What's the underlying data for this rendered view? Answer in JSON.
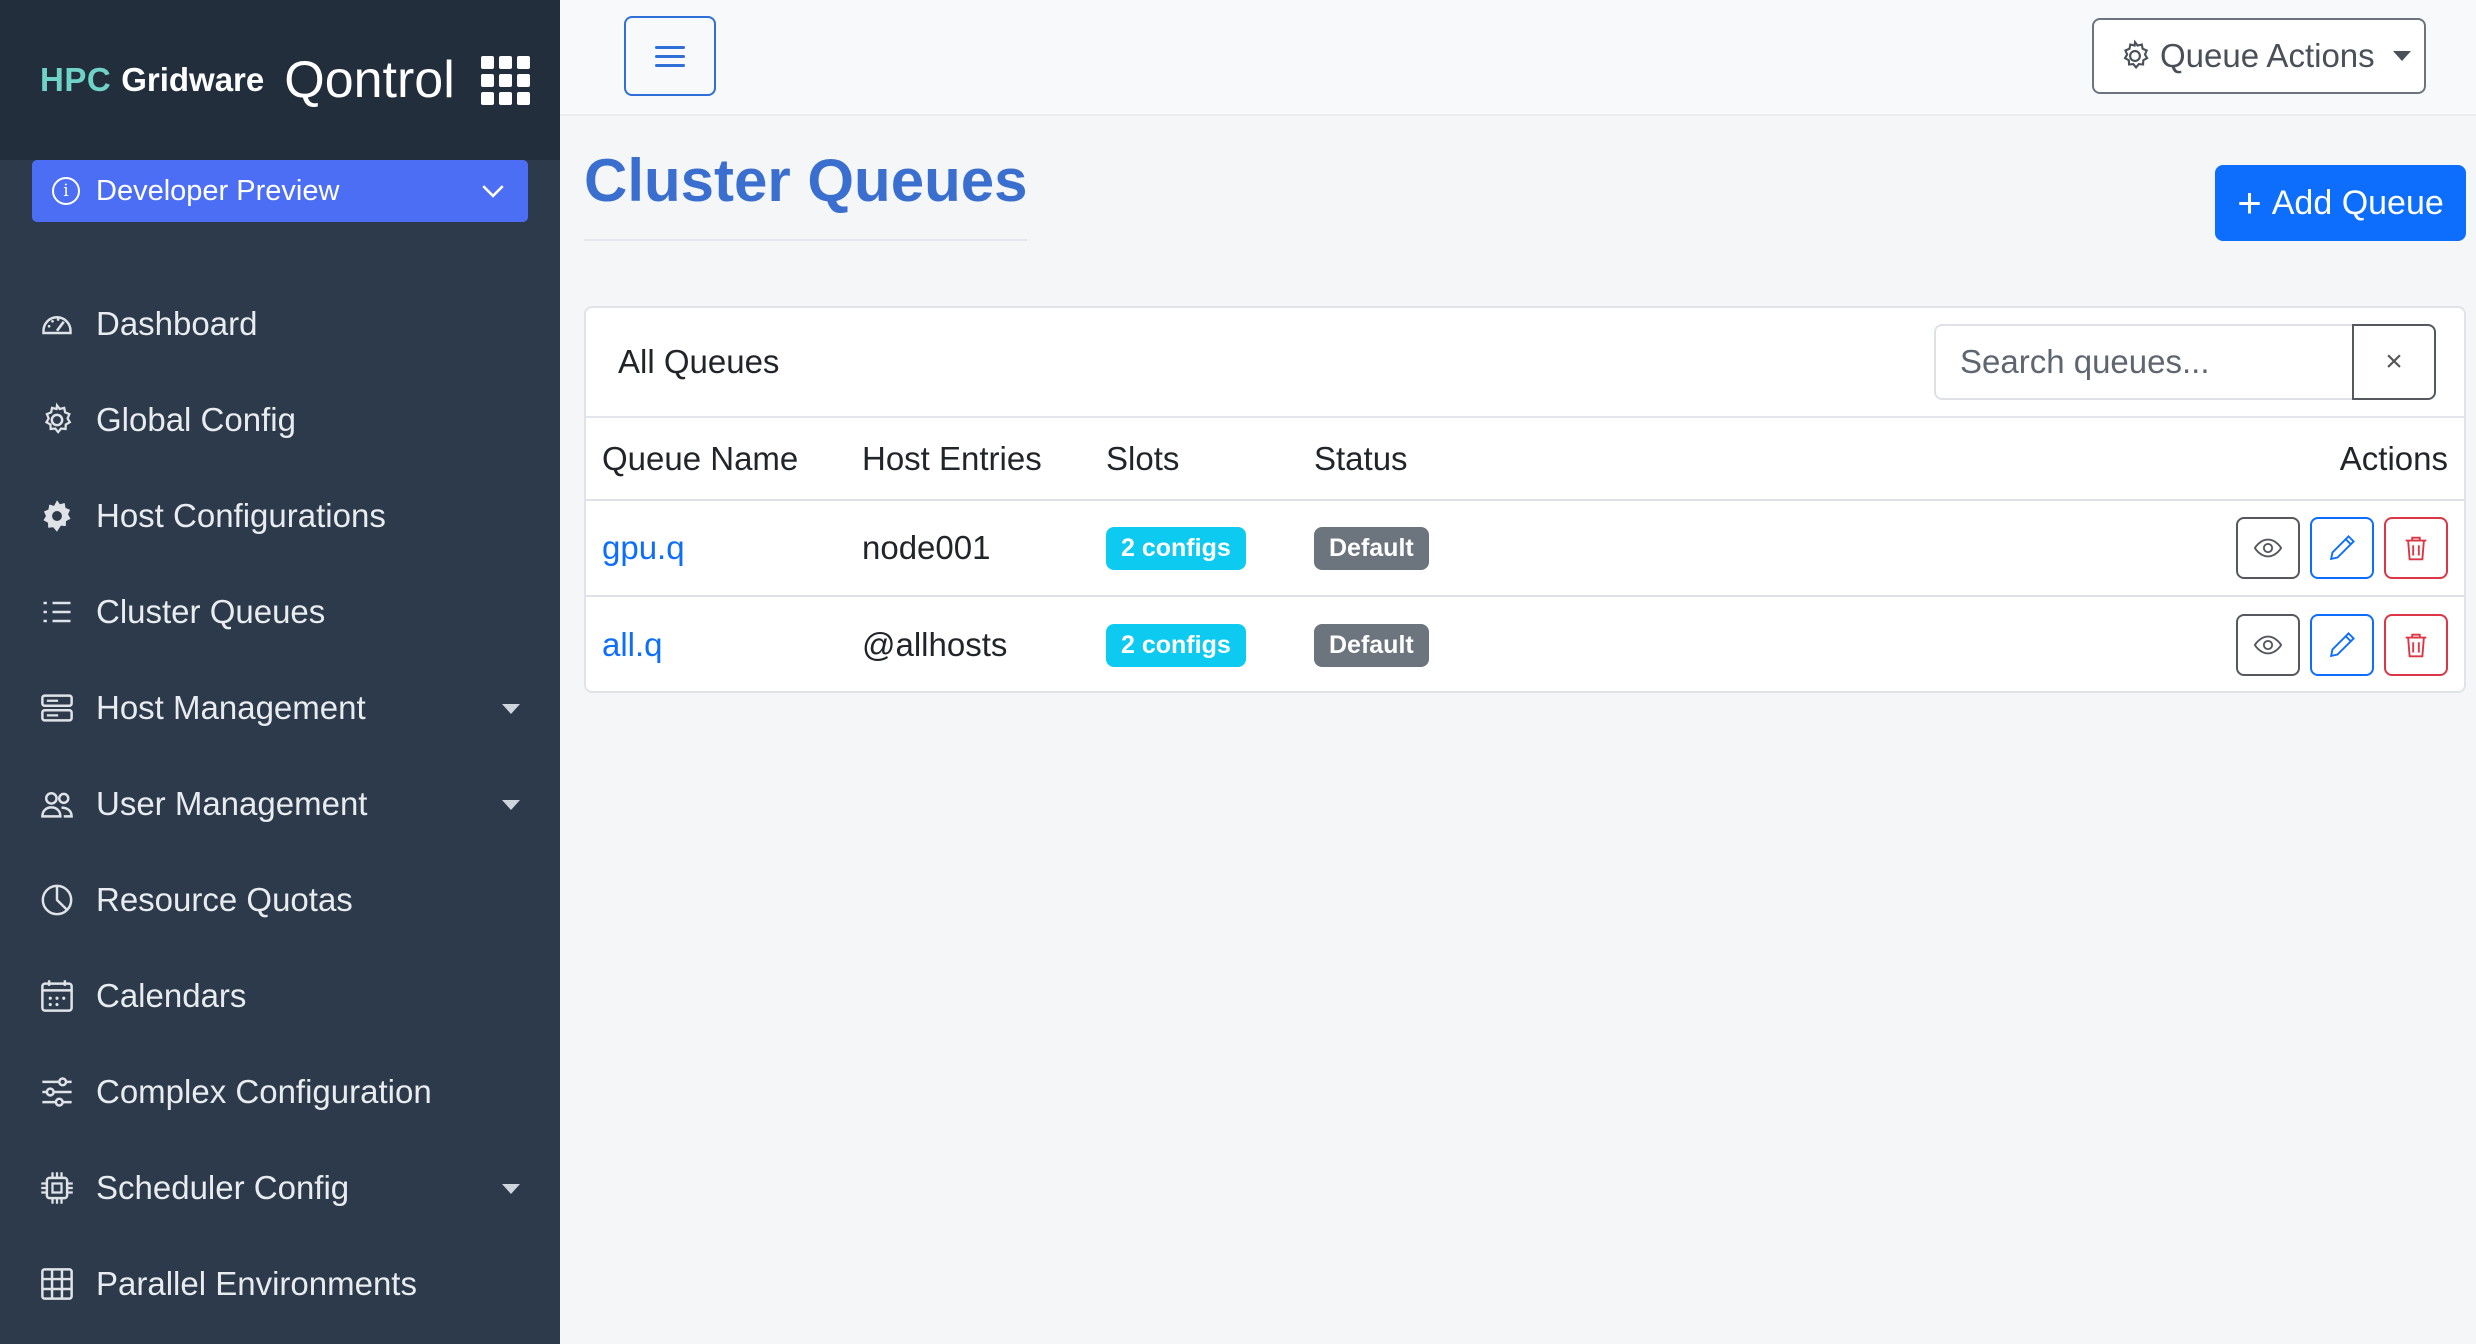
{
  "brand": {
    "hpc": "HPC",
    "gridware": "Gridware",
    "product": "Qontrol",
    "apps_icon": "grid-apps-icon"
  },
  "preview": {
    "label": "Developer Preview",
    "icon": "info-circle-icon"
  },
  "nav": {
    "items": [
      {
        "label": "Dashboard",
        "icon": "speedometer-icon",
        "has_submenu": false
      },
      {
        "label": "Global Config",
        "icon": "gear-outline-icon",
        "has_submenu": false
      },
      {
        "label": "Host Configurations",
        "icon": "gear-fill-icon",
        "has_submenu": false
      },
      {
        "label": "Cluster Queues",
        "icon": "list-task-icon",
        "has_submenu": false
      },
      {
        "label": "Host Management",
        "icon": "server-icon",
        "has_submenu": true
      },
      {
        "label": "User Management",
        "icon": "people-icon",
        "has_submenu": true
      },
      {
        "label": "Resource Quotas",
        "icon": "pie-chart-icon",
        "has_submenu": false
      },
      {
        "label": "Calendars",
        "icon": "calendar-icon",
        "has_submenu": false
      },
      {
        "label": "Complex Configuration",
        "icon": "sliders-icon",
        "has_submenu": false
      },
      {
        "label": "Scheduler Config",
        "icon": "cpu-icon",
        "has_submenu": true
      },
      {
        "label": "Parallel Environments",
        "icon": "table-grid-icon",
        "has_submenu": false
      }
    ]
  },
  "topbar": {
    "queue_actions": "Queue Actions"
  },
  "page": {
    "title": "Cluster Queues",
    "add_button": "Add Queue"
  },
  "card": {
    "title": "All Queues",
    "search_placeholder": "Search queues...",
    "clear": "×"
  },
  "table": {
    "headers": [
      "Queue Name",
      "Host Entries",
      "Slots",
      "Status",
      "Actions"
    ],
    "rows": [
      {
        "name": "gpu.q",
        "hosts": "node001",
        "slots": "2 configs",
        "status": "Default"
      },
      {
        "name": "all.q",
        "hosts": "@allhosts",
        "slots": "2 configs",
        "status": "Default"
      }
    ]
  },
  "colors": {
    "sidebar": "#2c3a4b",
    "brand_bg": "#232e3c",
    "accent": "#4c6ef5",
    "primary": "#0d6efd",
    "title": "#3a6fcf",
    "info": "#0dcaf0",
    "secondary": "#6c757d",
    "danger": "#dc3545"
  }
}
